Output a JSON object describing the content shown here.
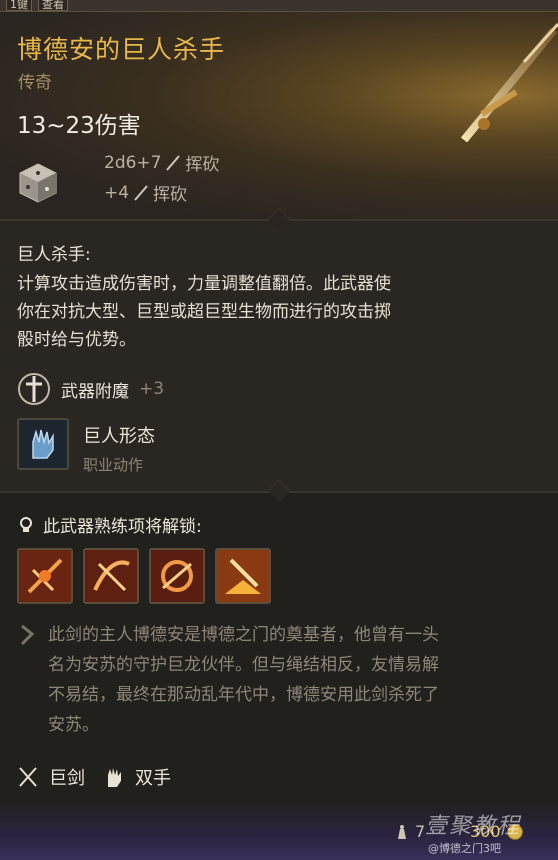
{
  "topbar": {
    "key_hint": "1键",
    "button_label": "查看"
  },
  "item": {
    "name": "博德安的巨人杀手",
    "rarity": "传奇",
    "damage": "13~23伤害",
    "damage_lines": [
      {
        "dice": "2d6+7",
        "type": "挥砍"
      },
      {
        "dice": "+4",
        "type": "挥砍"
      }
    ]
  },
  "ability": {
    "title": "巨人杀手:",
    "desc_lines": [
      "计算攻击造成伤害时，力量调整值翻倍。此武器使",
      "你在对抗大型、巨型或超巨型生物而进行的攻击掷",
      "骰时给与优势。"
    ]
  },
  "enchant": {
    "label": "武器附魔",
    "value": "+3"
  },
  "action": {
    "name": "巨人形态",
    "type": "职业动作"
  },
  "proficiency": {
    "title": "此武器熟练项将解锁:",
    "icon_names": [
      "flurry-icon",
      "cleave-icon",
      "topple-icon",
      "weakening-strike-icon"
    ]
  },
  "lore": {
    "lines": [
      "此剑的主人博德安是博德之门的奠基者，他曾有一头",
      "名为安苏的守护巨龙伙伴。但与绳结相反，友情易解",
      "不易结，最终在那动乱年代中，博德安用此剑杀死了",
      "安苏。"
    ]
  },
  "footer": {
    "weapon_type": "巨剑",
    "handedness": "双手"
  },
  "bottom": {
    "weight": "7",
    "price": "300",
    "watermark": "壹聚教程",
    "credit": "@博德之门3吧"
  },
  "colors": {
    "name": "#e8b84c",
    "rarity": "#a3906a",
    "lore": "#8e8679"
  }
}
